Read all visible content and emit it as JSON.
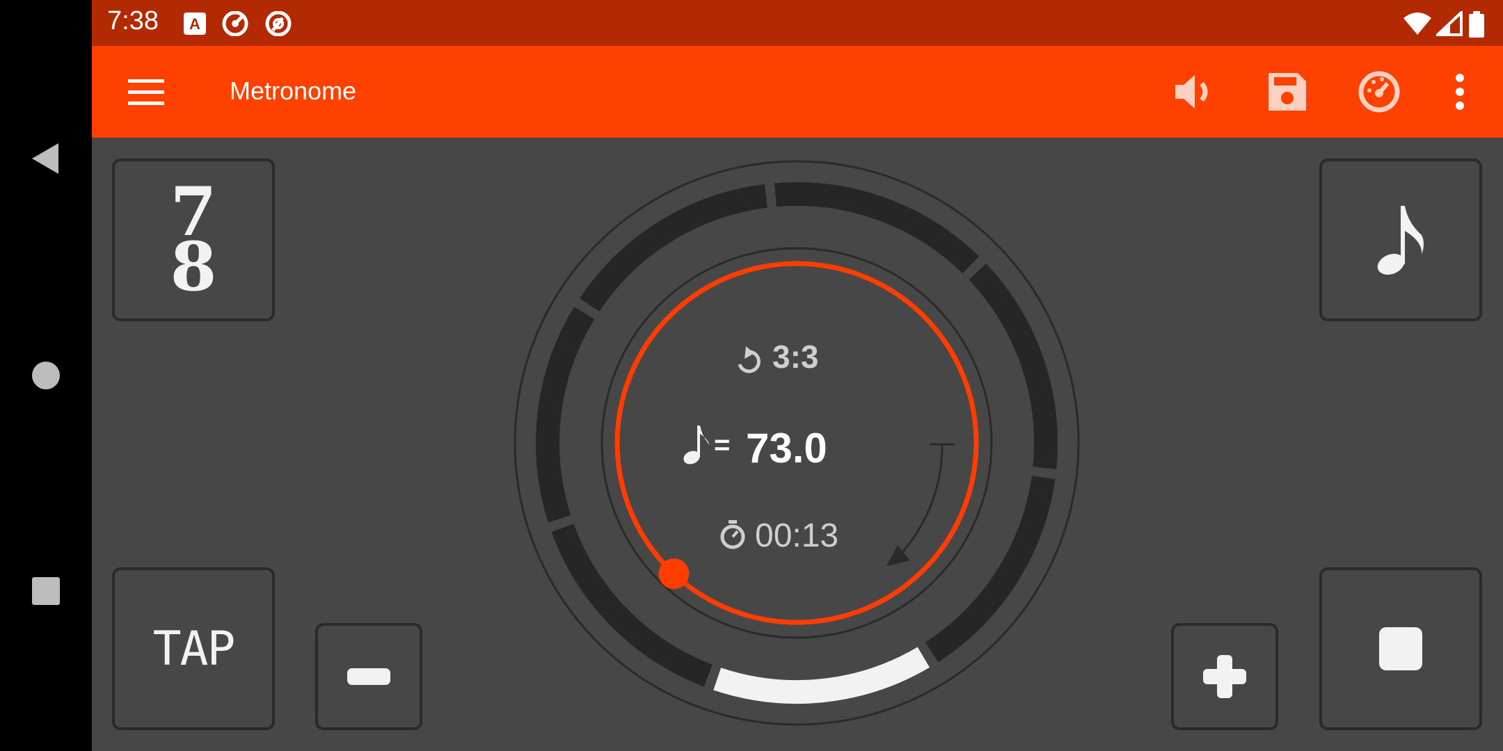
{
  "status_bar": {
    "time": "7:38",
    "icons": [
      "a-notification-icon",
      "speed-notification-icon",
      "at-notification-icon",
      "wifi-icon",
      "signal-icon",
      "battery-icon"
    ]
  },
  "toolbar": {
    "title": "Metronome",
    "actions": [
      "volume-icon",
      "save-icon",
      "tempo-gauge-icon",
      "more-options-icon"
    ],
    "color": "#ff4100"
  },
  "time_signature": {
    "numerator": "7",
    "denominator": "8"
  },
  "note_value_icon": "eighth-note-icon",
  "dial": {
    "repeat": "3:3",
    "tempo": "73.0",
    "tempo_equals": "=",
    "elapsed": "00:13",
    "beats_total": 7,
    "current_beat": 7,
    "progress_fraction": 0.62
  },
  "controls": {
    "tap_label": "TAP",
    "decrement": "minus-icon",
    "increment": "plus-icon",
    "stop": "stop-icon"
  }
}
